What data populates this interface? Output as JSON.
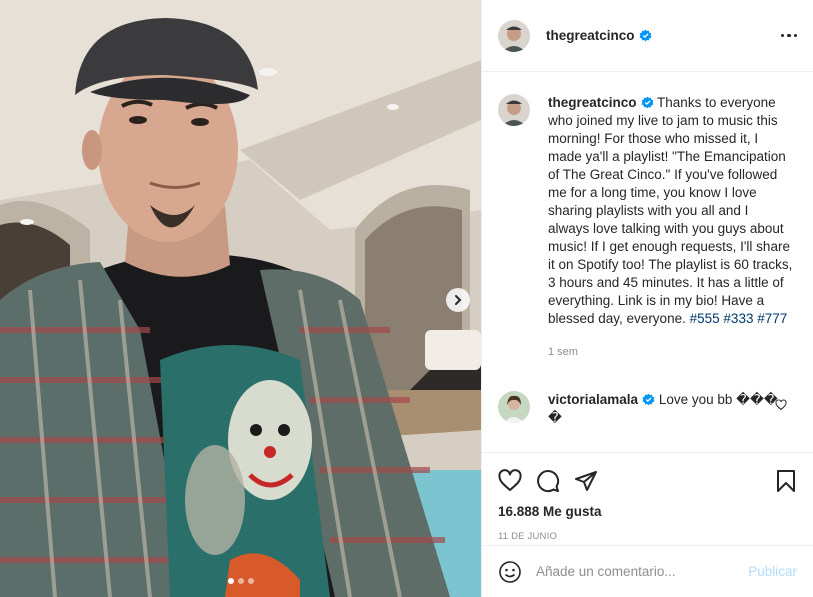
{
  "post": {
    "author": "thegreatcinco",
    "verified": true,
    "more_icon": "more-horizontal-icon",
    "carousel": {
      "dots": 3,
      "active_index": 0
    }
  },
  "caption": {
    "username": "thegreatcinco",
    "text": "Thanks to everyone who joined my live to jam to music this morning! For those who missed it, I made ya'll a playlist! \"The Emancipation of The Great Cinco.\" If you've followed me for a long time, you know I love sharing playlists with you all and I always love talking with you guys about music! If I get enough requests, I'll share it on Spotify too! The playlist is 60 tracks, 3 hours and 45 minutes. It has a little of everything. Link is in my bio! Have a blessed day, everyone.",
    "hashtags": [
      "#555",
      "#333",
      "#777"
    ],
    "time": "1 sem"
  },
  "comments": [
    {
      "username": "victorialamala",
      "verified": true,
      "text": "Love you bb ��� �"
    }
  ],
  "likes": "16.888 Me gusta",
  "date": "11 DE JUNIO",
  "add_comment": {
    "placeholder": "Añade un comentario...",
    "publish_label": "Publicar"
  },
  "colors": {
    "link": "#00376b",
    "verified": "#0095f6",
    "publish": "#b3dbff",
    "muted": "#8e8e8e"
  }
}
